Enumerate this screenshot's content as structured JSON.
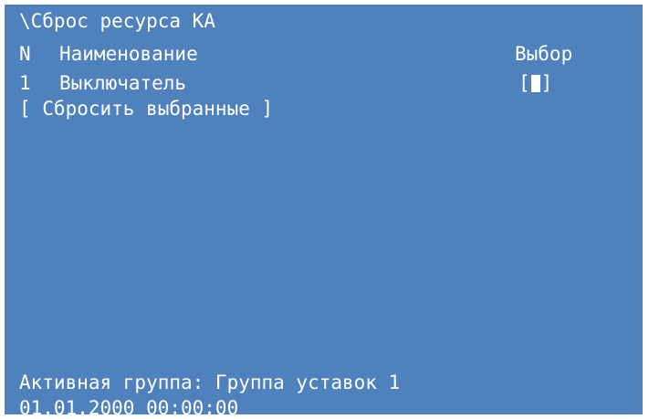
{
  "screen": {
    "title": "\\Сброс ресурса КА",
    "header": {
      "number_label": "N",
      "name_label": "Наименование",
      "choice_label": "Выбор"
    },
    "items": [
      {
        "number": "1",
        "name": "Выключатель",
        "checkbox_open": "[",
        "checkbox_close": "]",
        "selected": true
      }
    ],
    "reset_button_label": "[ Сбросить выбранные ]",
    "active_group": "Активная группа: Группа уставок 1",
    "datetime": "01.01.2000 00:00:00"
  }
}
